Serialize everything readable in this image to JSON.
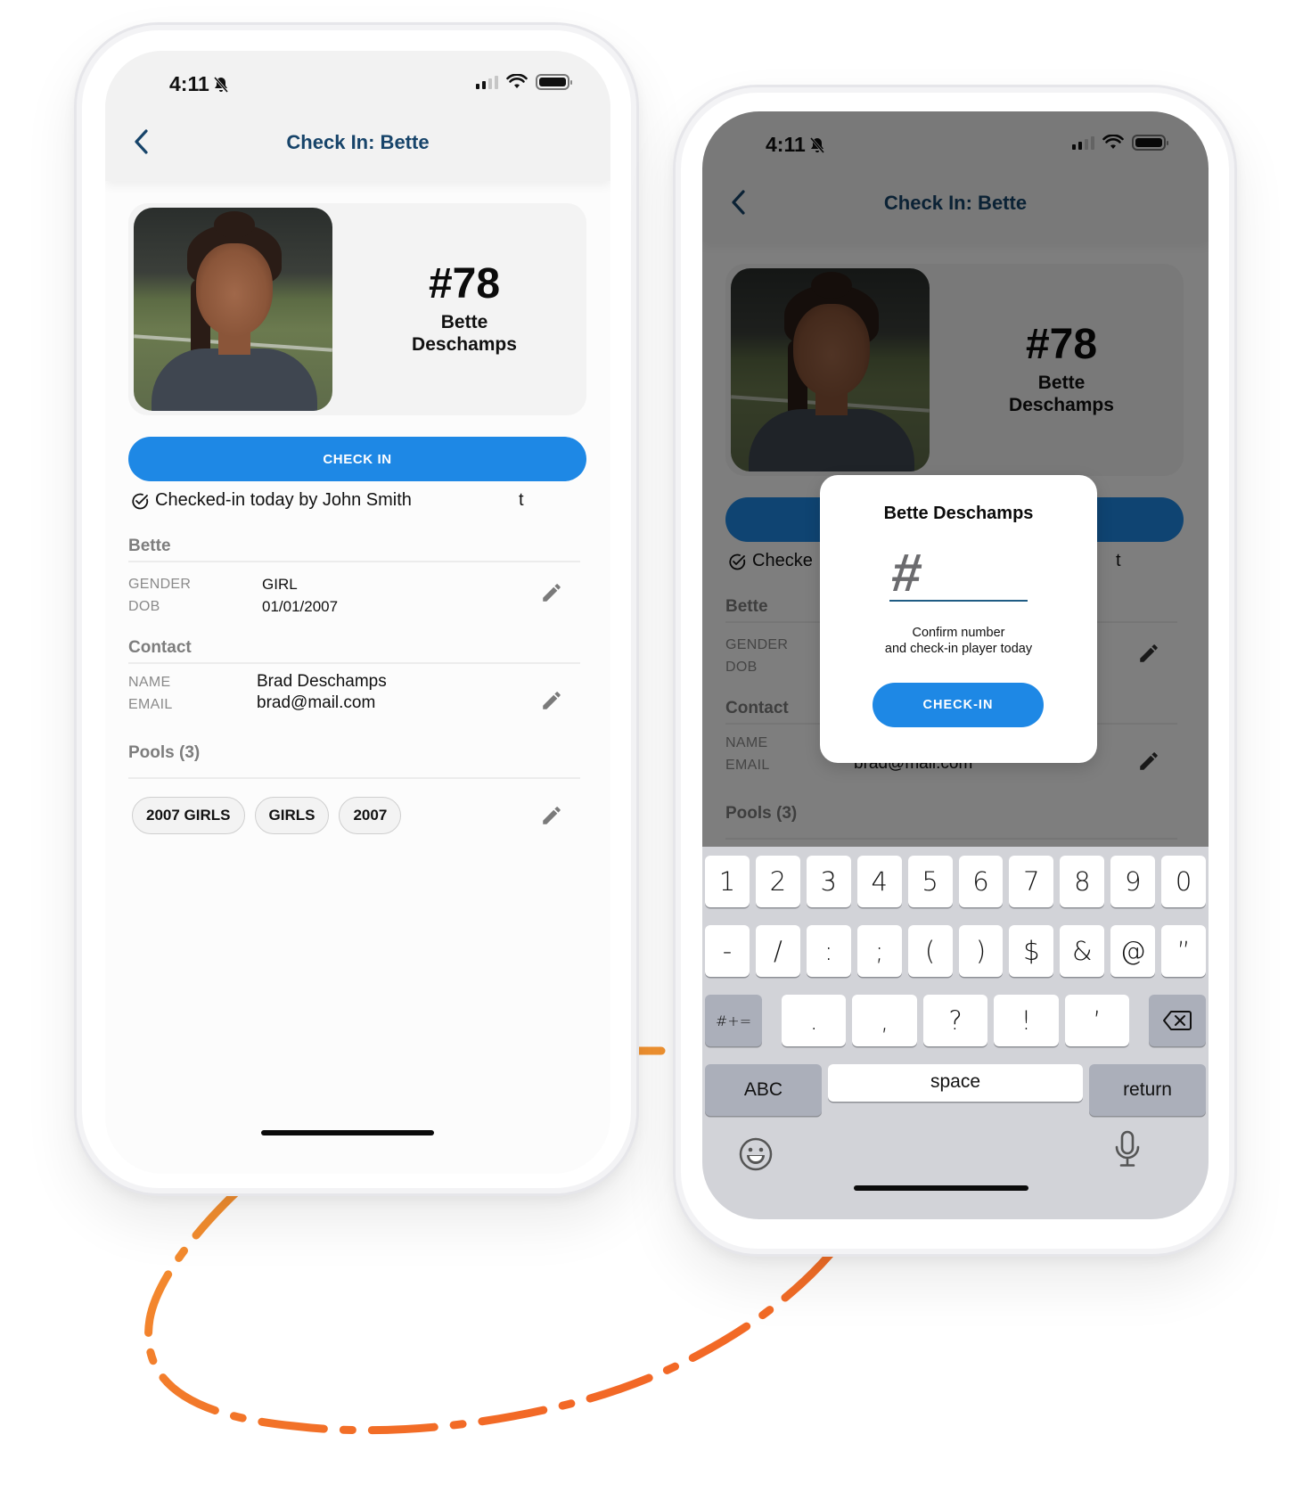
{
  "colors": {
    "accent": "#1e88e5",
    "title": "#17446a",
    "dash_orange": "#f26522",
    "overlay": "rgba(0,0,0,0.5)",
    "keyboard_bg": "#d2d3d8"
  },
  "left_phone": {
    "status": {
      "time": "4:11",
      "icons": [
        "bell-slash-icon",
        "signal-icon",
        "wifi-icon",
        "battery-icon"
      ]
    },
    "nav": {
      "title": "Check In: Bette",
      "back_icon": "chevron-left-icon"
    },
    "player_card": {
      "number": "#78",
      "first_name": "Bette",
      "last_name": "Deschamps"
    },
    "check_in_button": "CHECK IN",
    "checked_in_text": "Checked-in today by John Smith",
    "checked_in_trailing": "t",
    "player_section": {
      "title": "Bette",
      "fields": [
        {
          "label": "GENDER",
          "value": "GIRL"
        },
        {
          "label": "DOB",
          "value": "01/01/2007"
        }
      ]
    },
    "contact_section": {
      "title": "Contact",
      "fields": [
        {
          "label": "NAME",
          "value": "Brad Deschamps"
        },
        {
          "label": "EMAIL",
          "value": "brad@mail.com"
        }
      ]
    },
    "pools_section": {
      "title": "Pools (3)",
      "chips": [
        "2007 GIRLS",
        "GIRLS",
        "2007"
      ]
    }
  },
  "right_phone": {
    "status": {
      "time": "4:11"
    },
    "nav": {
      "title": "Check In: Bette"
    },
    "player_card": {
      "number": "#78",
      "first_name": "Bette",
      "last_name": "Deschamps"
    },
    "checked_in_text_partial": "Checke",
    "checked_in_trailing": "t",
    "player_section": {
      "title": "Bette",
      "labels": [
        "GENDER",
        "DOB"
      ]
    },
    "contact_section": {
      "title": "Contact",
      "labels": [
        "NAME",
        "EMAIL"
      ],
      "email": "brad@mail.com"
    },
    "pools_section": {
      "title": "Pools (3)"
    },
    "modal": {
      "title": "Bette Deschamps",
      "input_placeholder": "#",
      "input_value": "",
      "help_line1": "Confirm number",
      "help_line2": "and check-in player today",
      "button": "CHECK-IN"
    },
    "keyboard": {
      "row1": [
        "1",
        "2",
        "3",
        "4",
        "5",
        "6",
        "7",
        "8",
        "9",
        "0"
      ],
      "row2": [
        "-",
        "/",
        ":",
        ";",
        "(",
        ")",
        "$",
        "&",
        "@",
        "”"
      ],
      "row3": [
        ".",
        ",",
        "?",
        "!",
        "’"
      ],
      "symbols_key": "#+=",
      "backspace_icon": "backspace-icon",
      "abc_key": "ABC",
      "space_key": "space",
      "return_key": "return"
    }
  }
}
